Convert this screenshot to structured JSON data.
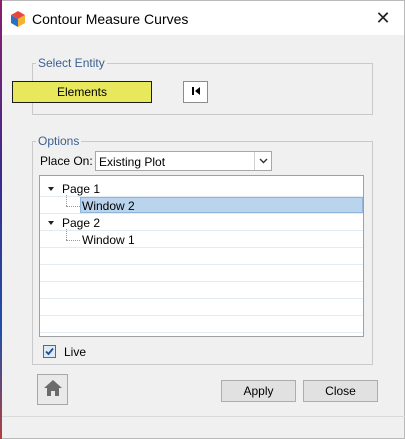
{
  "window": {
    "title": "Contour Measure Curves",
    "app_icon": "cube-icon",
    "close_icon": "close-icon",
    "close_glyph": "✕"
  },
  "select_entity": {
    "legend": "Select Entity",
    "elements_button_label": "Elements",
    "elements_button_color": "#e8e85c",
    "reset_icon": "reset-selection-icon"
  },
  "options": {
    "legend": "Options",
    "place_on_label": "Place On:",
    "place_on_value": "Existing Plot",
    "tree": [
      {
        "label": "Page 1",
        "level": 0,
        "expanded": true,
        "selected": false
      },
      {
        "label": "Window 2",
        "level": 1,
        "expanded": false,
        "selected": true
      },
      {
        "label": "Page 2",
        "level": 0,
        "expanded": true,
        "selected": false
      },
      {
        "label": "Window 1",
        "level": 1,
        "expanded": false,
        "selected": false
      }
    ],
    "live_label": "Live",
    "live_checked": true
  },
  "footer": {
    "home_icon": "home-icon",
    "apply_label": "Apply",
    "close_label": "Close"
  },
  "colors": {
    "legend_text": "#3a5f8f",
    "selection": "#b9d4ec",
    "check": "#1f4f8f"
  }
}
